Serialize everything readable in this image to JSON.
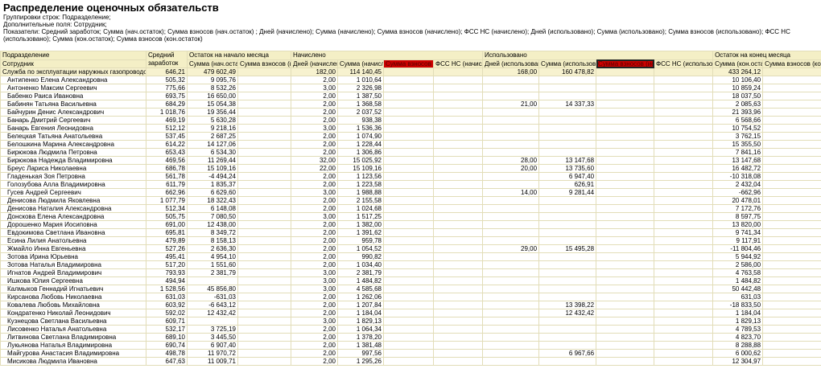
{
  "report": {
    "title": "Распределение оценочных обязательств",
    "meta": [
      "Группировки строк: Подразделение;",
      "Дополнительные поля: Сотрудник;",
      "Показатели: Средний заработок; Сумма (нач.остаток); Сумма взносов (нач.остаток) ; Дней (начислено); Сумма (начислено); Сумма взносов (начислено); ФСС НС (начислено); Дней (использовано); Сумма (использовано); Сумма взносов (использовано); ФСС НС (использовано); Сумма (кон.остаток); Сумма взносов (кон.остаток)"
    ]
  },
  "headers": {
    "h1": [
      "Подразделение",
      "Средний заработок",
      "Остаток на начало месяца",
      "Начислено",
      "Использовано",
      "Остаток на конец месяца"
    ],
    "h2": [
      "Сотрудник",
      "Сумма (нач.остаток)",
      "Сумма взносов (нач.остаток)",
      "Дней (начислено)",
      "Сумма (начислено)",
      "Сумма взносов (начислено)",
      "ФСС НС (начислено)",
      "Дней (использовано)",
      "Сумма (использовано)",
      "Сумма взносов (использовано)",
      "ФСС НС (использовано)",
      "Сумма (кон.остаток)",
      "Сумма взносов (кон.остаток)"
    ]
  },
  "group": [
    "Служба по эксплуатации наружных газопроводов",
    "646,21",
    "479 602,49",
    "",
    "182,00",
    "114 140,45",
    "",
    "",
    "168,00",
    "160 478,82",
    "",
    "",
    "433 264,12",
    ""
  ],
  "rows": [
    [
      "Антипенко Елена Александровна",
      "505,32",
      "9 095,76",
      "",
      "2,00",
      "1 010,64",
      "",
      "",
      "",
      "",
      "",
      "",
      "10 106,40",
      ""
    ],
    [
      "Антоненко Максим Сергеевич",
      "775,66",
      "8 532,26",
      "",
      "3,00",
      "2 326,98",
      "",
      "",
      "",
      "",
      "",
      "",
      "10 859,24",
      ""
    ],
    [
      "Бабенко Раиса Ивановна",
      "693,75",
      "16 650,00",
      "",
      "2,00",
      "1 387,50",
      "",
      "",
      "",
      "",
      "",
      "",
      "18 037,50",
      ""
    ],
    [
      "Бабинян Татьяна Васильевна",
      "684,29",
      "15 054,38",
      "",
      "2,00",
      "1 368,58",
      "",
      "",
      "21,00",
      "14 337,33",
      "",
      "",
      "2 085,63",
      ""
    ],
    [
      "Байчурин Денис Александрович",
      "1 018,76",
      "19 356,44",
      "",
      "2,00",
      "2 037,52",
      "",
      "",
      "",
      "",
      "",
      "",
      "21 393,96",
      ""
    ],
    [
      "Банарь Дмитрий Сергеевич",
      "469,19",
      "5 630,28",
      "",
      "2,00",
      "938,38",
      "",
      "",
      "",
      "",
      "",
      "",
      "6 568,66",
      ""
    ],
    [
      "Банарь Евгения Леонидовна",
      "512,12",
      "9 218,16",
      "",
      "3,00",
      "1 536,36",
      "",
      "",
      "",
      "",
      "",
      "",
      "10 754,52",
      ""
    ],
    [
      "Белецкая Татьяна Анатольевна",
      "537,45",
      "2 687,25",
      "",
      "2,00",
      "1 074,90",
      "",
      "",
      "",
      "",
      "",
      "",
      "3 762,15",
      ""
    ],
    [
      "Белошкина Марина Александровна",
      "614,22",
      "14 127,06",
      "",
      "2,00",
      "1 228,44",
      "",
      "",
      "",
      "",
      "",
      "",
      "15 355,50",
      ""
    ],
    [
      "Бирюкова Людмила Петровна",
      "653,43",
      "6 534,30",
      "",
      "2,00",
      "1 306,86",
      "",
      "",
      "",
      "",
      "",
      "",
      "7 841,16",
      ""
    ],
    [
      "Бирюкова Надежда Владимировна",
      "469,56",
      "11 269,44",
      "",
      "32,00",
      "15 025,92",
      "",
      "",
      "28,00",
      "13 147,68",
      "",
      "",
      "13 147,68",
      ""
    ],
    [
      "Бреус Лариса Николаевна",
      "686,78",
      "15 109,16",
      "",
      "22,00",
      "15 109,16",
      "",
      "",
      "20,00",
      "13 735,60",
      "",
      "",
      "16 482,72",
      ""
    ],
    [
      "Гладенькая Зоя Петровна",
      "561,78",
      "-4 494,24",
      "",
      "2,00",
      "1 123,56",
      "",
      "",
      "",
      "6 947,40",
      "",
      "",
      "-10 318,08",
      ""
    ],
    [
      "Голозубова Алла Владимировна",
      "611,79",
      "1 835,37",
      "",
      "2,00",
      "1 223,58",
      "",
      "",
      "",
      "626,91",
      "",
      "",
      "2 432,04",
      ""
    ],
    [
      "Гусев Андрей Сергеевич",
      "662,96",
      "6 629,60",
      "",
      "3,00",
      "1 988,88",
      "",
      "",
      "14,00",
      "9 281,44",
      "",
      "",
      "-662,96",
      ""
    ],
    [
      "Денисова Людмила Яковлевна",
      "1 077,79",
      "18 322,43",
      "",
      "2,00",
      "2 155,58",
      "",
      "",
      "",
      "",
      "",
      "",
      "20 478,01",
      ""
    ],
    [
      "Денисова Наталия Александровна",
      "512,34",
      "6 148,08",
      "",
      "2,00",
      "1 024,68",
      "",
      "",
      "",
      "",
      "",
      "",
      "7 172,76",
      ""
    ],
    [
      "Донскова Елена Александровна",
      "505,75",
      "7 080,50",
      "",
      "3,00",
      "1 517,25",
      "",
      "",
      "",
      "",
      "",
      "",
      "8 597,75",
      ""
    ],
    [
      "Дорошенко Мария Иосиповна",
      "691,00",
      "12 438,00",
      "",
      "2,00",
      "1 382,00",
      "",
      "",
      "",
      "",
      "",
      "",
      "13 820,00",
      ""
    ],
    [
      "Евдокимова Светлана Ивановна",
      "695,81",
      "8 349,72",
      "",
      "2,00",
      "1 391,62",
      "",
      "",
      "",
      "",
      "",
      "",
      "9 741,34",
      ""
    ],
    [
      "Есина Лилия Анатольевна",
      "479,89",
      "8 158,13",
      "",
      "2,00",
      "959,78",
      "",
      "",
      "",
      "",
      "",
      "",
      "9 117,91",
      ""
    ],
    [
      "Жмайло Инна Евгеньевна",
      "527,26",
      "2 636,30",
      "",
      "2,00",
      "1 054,52",
      "",
      "",
      "29,00",
      "15 495,28",
      "",
      "",
      "-11 804,46",
      ""
    ],
    [
      "Зотова Ирина Юрьевна",
      "495,41",
      "4 954,10",
      "",
      "2,00",
      "990,82",
      "",
      "",
      "",
      "",
      "",
      "",
      "5 944,92",
      ""
    ],
    [
      "Зотова Наталья Владимировна",
      "517,20",
      "1 551,60",
      "",
      "2,00",
      "1 034,40",
      "",
      "",
      "",
      "",
      "",
      "",
      "2 586,00",
      ""
    ],
    [
      "Игнатов Андрей Владимирович",
      "793,93",
      "2 381,79",
      "",
      "3,00",
      "2 381,79",
      "",
      "",
      "",
      "",
      "",
      "",
      "4 763,58",
      ""
    ],
    [
      "Ишкова Юлия Сергеевна",
      "494,94",
      "",
      "",
      "3,00",
      "1 484,82",
      "",
      "",
      "",
      "",
      "",
      "",
      "1 484,82",
      ""
    ],
    [
      "Калмыков Геннадий Игнатьевич",
      "1 528,56",
      "45 856,80",
      "",
      "3,00",
      "4 585,68",
      "",
      "",
      "",
      "",
      "",
      "",
      "50 442,48",
      ""
    ],
    [
      "Кирсанова Любовь Николаевна",
      "631,03",
      "-631,03",
      "",
      "2,00",
      "1 262,06",
      "",
      "",
      "",
      "",
      "",
      "",
      "631,03",
      ""
    ],
    [
      "Ковалева Любовь Михайловна",
      "603,92",
      "-6 643,12",
      "",
      "2,00",
      "1 207,84",
      "",
      "",
      "",
      "13 398,22",
      "",
      "",
      "-18 833,50",
      ""
    ],
    [
      "Кондратенко Николай Леонидович",
      "592,02",
      "12 432,42",
      "",
      "2,00",
      "1 184,04",
      "",
      "",
      "",
      "12 432,42",
      "",
      "",
      "1 184,04",
      ""
    ],
    [
      "Кузнецова Светлана Васильевна",
      "609,71",
      "",
      "",
      "3,00",
      "1 829,13",
      "",
      "",
      "",
      "",
      "",
      "",
      "1 829,13",
      ""
    ],
    [
      "Лисовенко Наталья Анатольевна",
      "532,17",
      "3 725,19",
      "",
      "2,00",
      "1 064,34",
      "",
      "",
      "",
      "",
      "",
      "",
      "4 789,53",
      ""
    ],
    [
      "Литвинова Светлана Владимировна",
      "689,10",
      "3 445,50",
      "",
      "2,00",
      "1 378,20",
      "",
      "",
      "",
      "",
      "",
      "",
      "4 823,70",
      ""
    ],
    [
      "Лукьянова Наталья Владимировна",
      "690,74",
      "6 907,40",
      "",
      "2,00",
      "1 381,48",
      "",
      "",
      "",
      "",
      "",
      "",
      "8 288,88",
      ""
    ],
    [
      "Майгурова Анастасия Владимировна",
      "498,78",
      "11 970,72",
      "",
      "2,00",
      "997,56",
      "",
      "",
      "",
      "6 967,66",
      "",
      "",
      "6 000,62",
      ""
    ],
    [
      "Мисикова Людмила Ивановна",
      "647,63",
      "11 009,71",
      "",
      "2,00",
      "1 295,26",
      "",
      "",
      "",
      "",
      "",
      "",
      "12 304,97",
      ""
    ]
  ]
}
